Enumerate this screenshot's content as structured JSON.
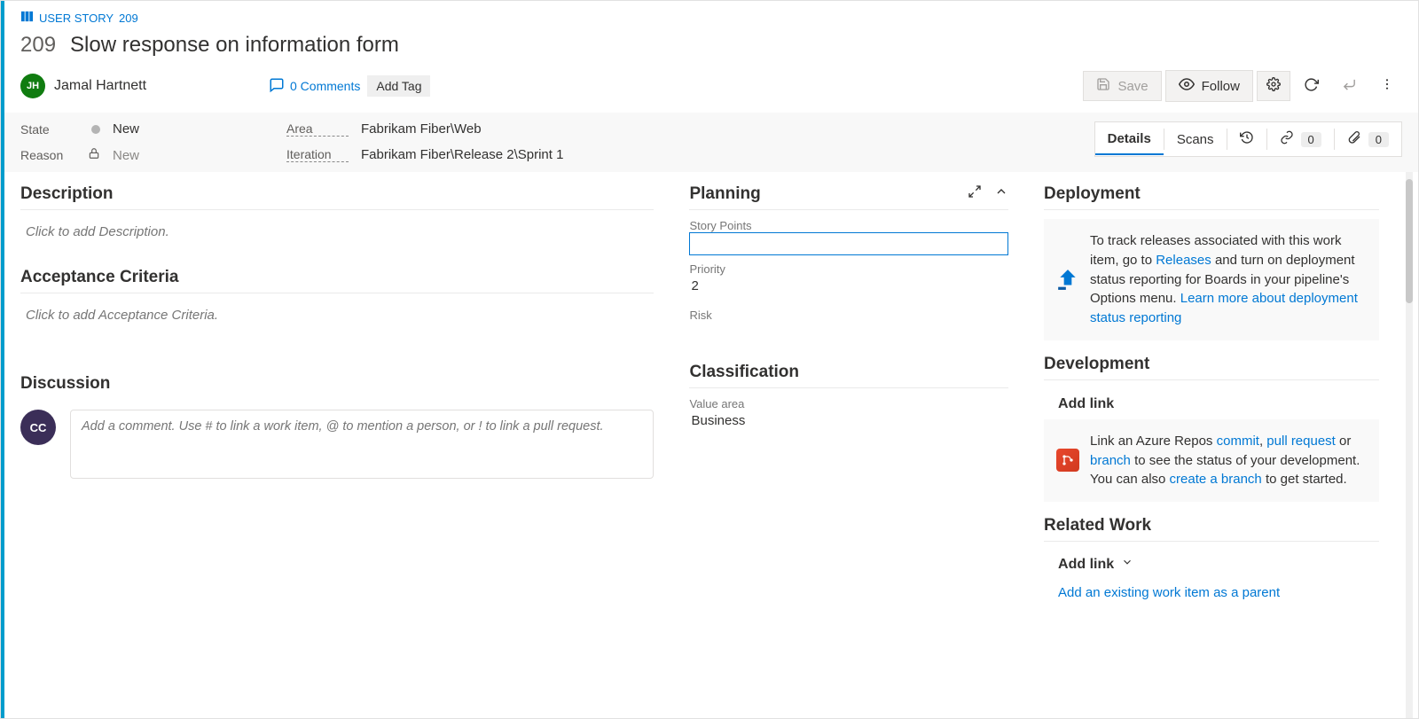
{
  "crumb": {
    "type_label": "USER STORY",
    "id_label": "209"
  },
  "work_item": {
    "id": "209",
    "title": "Slow response on information form",
    "assignee": {
      "initials": "JH",
      "name": "Jamal Hartnett"
    }
  },
  "comments": {
    "count_label": "0 Comments"
  },
  "add_tag_label": "Add Tag",
  "toolbar": {
    "save": "Save",
    "follow": "Follow"
  },
  "meta": {
    "state_label": "State",
    "state_value": "New",
    "reason_label": "Reason",
    "reason_value": "New",
    "area_label": "Area",
    "area_value": "Fabrikam Fiber\\Web",
    "iteration_label": "Iteration",
    "iteration_value": "Fabrikam Fiber\\Release 2\\Sprint 1"
  },
  "tabs": {
    "details": "Details",
    "scans": "Scans",
    "links_count": "0",
    "attachments_count": "0"
  },
  "left": {
    "description_head": "Description",
    "description_placeholder": "Click to add Description.",
    "acceptance_head": "Acceptance Criteria",
    "acceptance_placeholder": "Click to add Acceptance Criteria.",
    "discussion_head": "Discussion",
    "discussion_avatar_initials": "CC",
    "discussion_placeholder": "Add a comment. Use # to link a work item, @ to mention a person, or ! to link a pull request."
  },
  "mid": {
    "planning_head": "Planning",
    "story_points_label": "Story Points",
    "story_points_value": "",
    "priority_label": "Priority",
    "priority_value": "2",
    "risk_label": "Risk",
    "classification_head": "Classification",
    "value_area_label": "Value area",
    "value_area_value": "Business"
  },
  "right": {
    "deployment_head": "Deployment",
    "deployment_text_a": "To track releases associated with this work item, go to ",
    "deployment_link_releases": "Releases",
    "deployment_text_b": " and turn on deployment status reporting for Boards in your pipeline's Options menu. ",
    "deployment_link_learn": "Learn more about deployment status reporting",
    "development_head": "Development",
    "development_addlink": "Add link",
    "dev_text_a": "Link an Azure Repos ",
    "dev_link_commit": "commit",
    "dev_sep1": ", ",
    "dev_link_pr": "pull request",
    "dev_sep2": " or ",
    "dev_link_branch": "branch",
    "dev_text_b": " to see the status of your development. You can also ",
    "dev_link_create": "create a branch",
    "dev_text_c": " to get started.",
    "related_head": "Related Work",
    "related_addlink": "Add link",
    "related_parent": "Add an existing work item as a parent"
  }
}
